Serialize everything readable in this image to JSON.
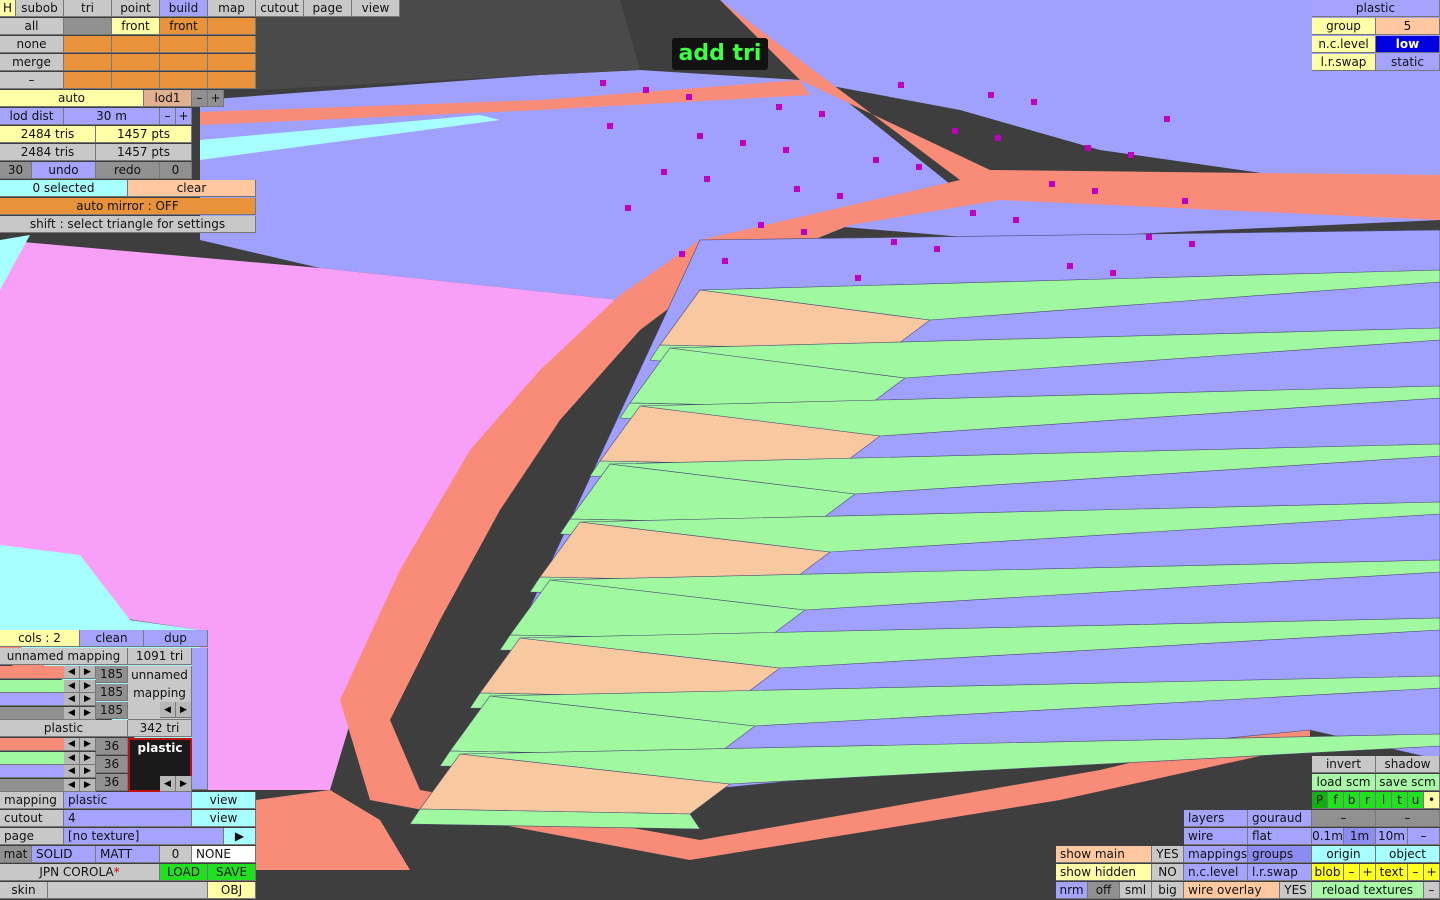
{
  "tabs": {
    "h": "H",
    "subob": "subob",
    "tri": "tri",
    "point": "point",
    "build": "build",
    "map": "map",
    "cutout": "cutout",
    "page": "page",
    "view": "view"
  },
  "sel": {
    "all": "all",
    "none": "none",
    "merge": "merge",
    "dash": "–",
    "front1": "front",
    "front2": "front"
  },
  "lod": {
    "auto": "auto",
    "lod": "lod1",
    "minus": "–",
    "plus": "+",
    "dist_label": "lod dist",
    "dist": "30 m"
  },
  "stats": {
    "tris1": "2484 tris",
    "pts1": "1457 pts",
    "tris2": "2484 tris",
    "pts2": "1457 pts"
  },
  "undo": {
    "count": "30",
    "undo": "undo",
    "redo": "redo",
    "redo_count": "0"
  },
  "selection": {
    "selected": "0 selected",
    "clear": "clear",
    "mirror": "auto mirror : OFF",
    "hint": "shift : select triangle for settings"
  },
  "viewport": {
    "mode_label": "add tri"
  },
  "topright": {
    "title": "plastic",
    "group_label": "group",
    "group": "5",
    "nc_label": "n.c.level",
    "nc": "low",
    "lr_label": "l.r.swap",
    "lr": "static"
  },
  "colors": {
    "cols": "cols : 2",
    "clean": "clean",
    "dup": "dup",
    "mapping_name": "unnamed mapping",
    "mapping_tris": "1091 tri",
    "mapping_values": [
      "185",
      "185",
      "185"
    ],
    "mapping_preview": "unnamed mapping",
    "material_name": "plastic",
    "material_tris": "342 tri",
    "material_values": [
      "36",
      "36",
      "36"
    ],
    "material_preview": "plastic"
  },
  "props": {
    "mapping_label": "mapping",
    "mapping": "plastic",
    "view1": "view",
    "cutout_label": "cutout",
    "cutout": "4",
    "view2": "view",
    "page_label": "page",
    "page": "[no texture]",
    "play": "▶",
    "mat": "mat",
    "solid": "SOLID",
    "matt": "MATT",
    "mat_num": "0",
    "none": "NONE",
    "file": "JPN COROLA",
    "modified": "*",
    "load": "LOAD",
    "save": "SAVE",
    "skin": "skin",
    "obj": "OBJ"
  },
  "display": {
    "invert": "invert",
    "shadow": "shadow",
    "load_scm": "load scm",
    "save_scm": "save scm",
    "views": [
      "P",
      "f",
      "b",
      "r",
      "l",
      "t",
      "u",
      "•"
    ],
    "layers": "layers",
    "gouraud": "gouraud",
    "dash1": "–",
    "dash2": "–",
    "wire": "wire",
    "flat": "flat",
    "g01": "0.1m",
    "g1": "1m",
    "g10": "10m",
    "gdash": "–",
    "show_main": "show main",
    "show_main_v": "YES",
    "mappings": "mappings",
    "groups": "groups",
    "origin": "origin",
    "object": "object",
    "show_hidden": "show hidden",
    "show_hidden_v": "NO",
    "nc_level": "n.c.level",
    "lr_swap": "l.r.swap",
    "blob": "blob",
    "minus": "–",
    "plus": "+",
    "text": "text",
    "nrm": "nrm",
    "off": "off",
    "sml": "sml",
    "big": "big",
    "wire_overlay": "wire overlay",
    "wire_overlay_v": "YES",
    "reload": "reload textures",
    "rdash": "–"
  },
  "palette": {
    "red": "#f88c78",
    "green": "#a0f8a0",
    "blue": "#a0a0ff",
    "pink": "#f8a0f8",
    "peach": "#f8c8a0",
    "cyan": "#a8ffff"
  }
}
